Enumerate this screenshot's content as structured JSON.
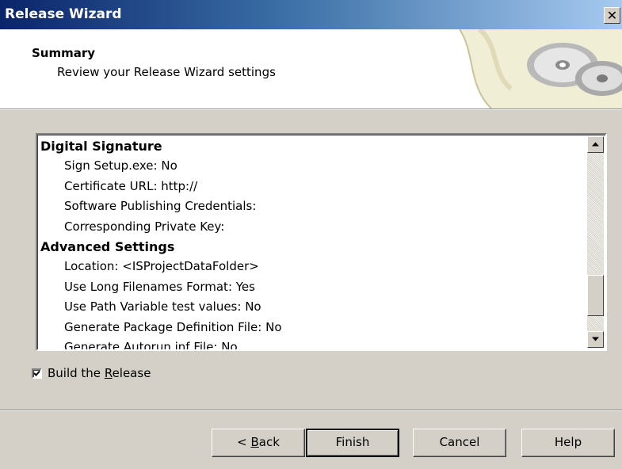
{
  "window": {
    "title": "Release Wizard",
    "close_glyph": "✕"
  },
  "header": {
    "heading": "Summary",
    "subheading": "Review your Release Wizard settings"
  },
  "summary_list": {
    "lines": [
      {
        "kind": "section",
        "text": "Digital Signature"
      },
      {
        "kind": "item",
        "text": "Sign Setup.exe: No"
      },
      {
        "kind": "item",
        "text": "Certificate URL: http://"
      },
      {
        "kind": "item",
        "text": "Software Publishing Credentials:"
      },
      {
        "kind": "item",
        "text": "Corresponding Private Key:"
      },
      {
        "kind": "section",
        "text": "Advanced Settings"
      },
      {
        "kind": "item",
        "text": "Location: <ISProjectDataFolder>"
      },
      {
        "kind": "item",
        "text": "Use Long Filenames Format: Yes"
      },
      {
        "kind": "item",
        "text": "Use Path Variable test values: No"
      },
      {
        "kind": "item",
        "text": "Generate Package Definition File: No"
      },
      {
        "kind": "item",
        "text": "Generate Autorun.inf File: No"
      }
    ]
  },
  "build_checkbox": {
    "checked": true,
    "label_before": "Build the ",
    "label_mnemonic": "R",
    "label_after": "elease"
  },
  "buttons": {
    "back_prefix": "< ",
    "back_mnemonic": "B",
    "back_suffix": "ack",
    "finish": "Finish",
    "cancel": "Cancel",
    "help": "Help"
  },
  "icons": {
    "close": "close-icon",
    "scroll_up": "scroll-up-arrow-icon",
    "scroll_down": "scroll-down-arrow-icon",
    "checkmark": "checkmark-icon",
    "header_art": "disc-scroll-graphic"
  }
}
